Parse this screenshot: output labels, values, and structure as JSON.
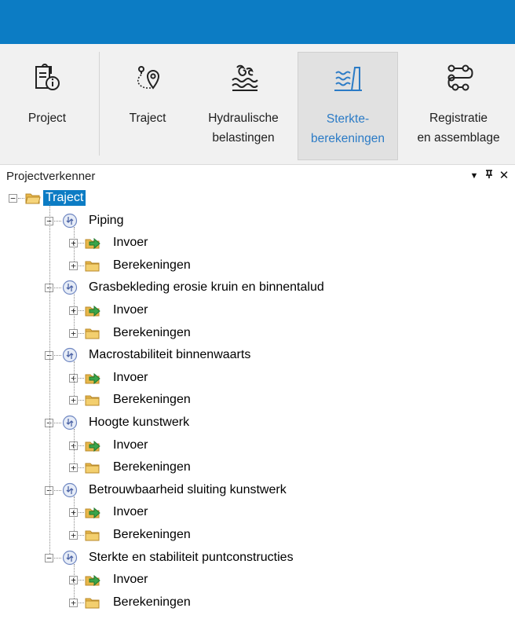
{
  "ribbon": {
    "buttons": [
      {
        "label": "Project",
        "icon": "project-info-icon"
      },
      {
        "label": "Traject",
        "icon": "route-pin-icon"
      },
      {
        "label": "Hydraulische\nbelastingen",
        "icon": "waves-icon"
      },
      {
        "label": "Sterkte-\nberekeningen",
        "icon": "dike-waves-icon",
        "active": true
      },
      {
        "label": "Registratie\nen assemblage",
        "icon": "flow-nodes-icon"
      }
    ]
  },
  "panel": {
    "title": "Projectverkenner",
    "dropdown_glyph": "▼",
    "pin_glyph": "ᵖ",
    "close_glyph": "✕"
  },
  "tree": {
    "root": {
      "label": "Traject",
      "icon": "folder-open-icon",
      "expander": "−"
    },
    "collapse_glyph": "−",
    "expand_glyph": "+",
    "mechanisms": [
      {
        "label": "Piping",
        "children": [
          {
            "label": "Invoer"
          },
          {
            "label": "Berekeningen"
          }
        ]
      },
      {
        "label": "Grasbekleding erosie kruin en binnentalud",
        "children": [
          {
            "label": "Invoer"
          },
          {
            "label": "Berekeningen"
          }
        ]
      },
      {
        "label": "Macrostabiliteit binnenwaarts",
        "children": [
          {
            "label": "Invoer"
          },
          {
            "label": "Berekeningen"
          }
        ]
      },
      {
        "label": "Hoogte kunstwerk",
        "children": [
          {
            "label": "Invoer"
          },
          {
            "label": "Berekeningen"
          }
        ]
      },
      {
        "label": "Betrouwbaarheid sluiting kunstwerk",
        "children": [
          {
            "label": "Invoer"
          },
          {
            "label": "Berekeningen"
          }
        ]
      },
      {
        "label": "Sterkte en stabiliteit puntconstructies",
        "children": [
          {
            "label": "Invoer"
          },
          {
            "label": "Berekeningen"
          }
        ]
      }
    ]
  },
  "colors": {
    "accent": "#0c7cc4",
    "active_text": "#2b7bc6",
    "ribbon_bg": "#f1f1f1"
  }
}
